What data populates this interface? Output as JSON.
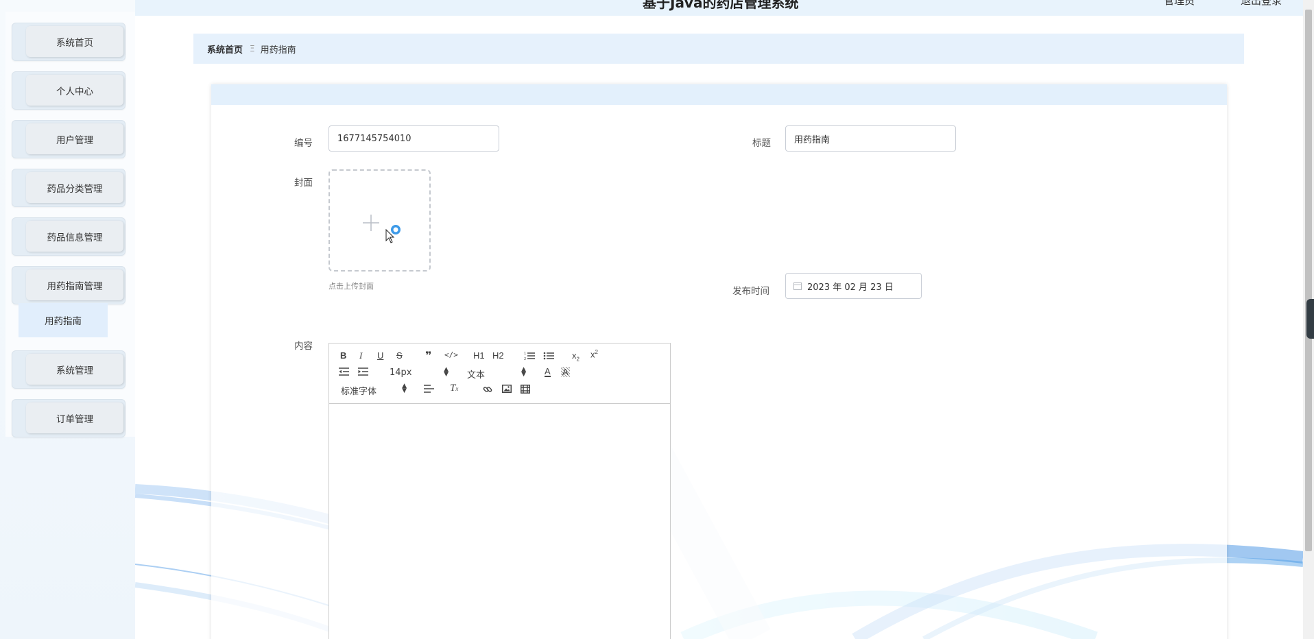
{
  "header": {
    "app_title": "基于Java的药店管理系统",
    "right_item_1": "管理员",
    "right_item_2": "退出登录"
  },
  "sidebar": {
    "items": [
      {
        "label": "系统首页"
      },
      {
        "label": "个人中心"
      },
      {
        "label": "用户管理"
      },
      {
        "label": "药品分类管理"
      },
      {
        "label": "药品信息管理"
      },
      {
        "label": "用药指南管理"
      },
      {
        "label": "系统管理"
      },
      {
        "label": "订单管理"
      }
    ],
    "sub_item": "用药指南"
  },
  "breadcrumb": {
    "home": "系统首页",
    "separator": "Ξ",
    "current": "用药指南"
  },
  "form": {
    "id_label": "编号",
    "id_value": "1677145754010",
    "title_label": "标题",
    "title_value": "用药指南",
    "cover_label": "封面",
    "cover_hint": "点击上传封面",
    "publish_label": "发布时间",
    "publish_value": "2023 年 02 月 23 日",
    "content_label": "内容"
  },
  "editor": {
    "font_size": "14px",
    "header_type": "文本",
    "font_family": "标准字体",
    "h1": "H1",
    "h2": "H2"
  },
  "colors": {
    "accent": "#409eff",
    "breadcrumb_bg": "#e6f1fc",
    "sidebar_sub_bg": "#e1eefc"
  }
}
